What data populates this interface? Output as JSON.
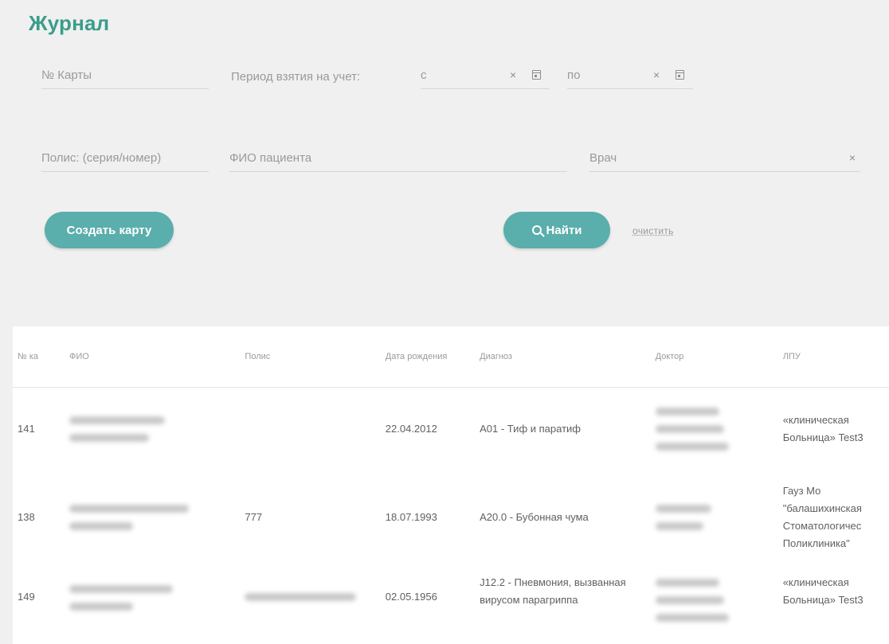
{
  "page": {
    "title": "Журнал"
  },
  "filters": {
    "card_number": {
      "placeholder": "№ Карты"
    },
    "period_label": "Период взятия на учет:",
    "date_from": {
      "placeholder": "с"
    },
    "date_to": {
      "placeholder": "по"
    },
    "policy": {
      "placeholder": "Полис: (серия/номер)"
    },
    "patient_name": {
      "placeholder": "ФИО пациента"
    },
    "doctor": {
      "placeholder": "Врач"
    },
    "clear_glyph": "×"
  },
  "actions": {
    "create_card": "Создать карту",
    "search": "Найти",
    "clear": "очистить"
  },
  "table": {
    "columns": [
      "№ ка",
      "ФИО",
      "Полис",
      "Дата рождения",
      "Диагноз",
      "Доктор",
      "ЛПУ"
    ],
    "rows": [
      {
        "number": "141",
        "policy": "",
        "birth_date": "22.04.2012",
        "diagnosis": "A01 - Тиф и паратиф",
        "lpu": "«клиническая Больница» Test3"
      },
      {
        "number": "138",
        "policy": "777",
        "birth_date": "18.07.1993",
        "diagnosis": "A20.0 - Бубонная чума",
        "lpu": "Гауз Мо \"балашихинская Стоматологичес Поликлиника\""
      },
      {
        "number": "149",
        "policy": "",
        "birth_date": "02.05.1956",
        "diagnosis": "J12.2 - Пневмония, вызванная вирусом парагриппа",
        "lpu": "«клиническая Больница» Test3"
      }
    ]
  },
  "colors": {
    "accent": "#3a9d8a",
    "button": "#5aaeac",
    "background": "#f0f0f0",
    "table_bg": "#ffffff"
  }
}
